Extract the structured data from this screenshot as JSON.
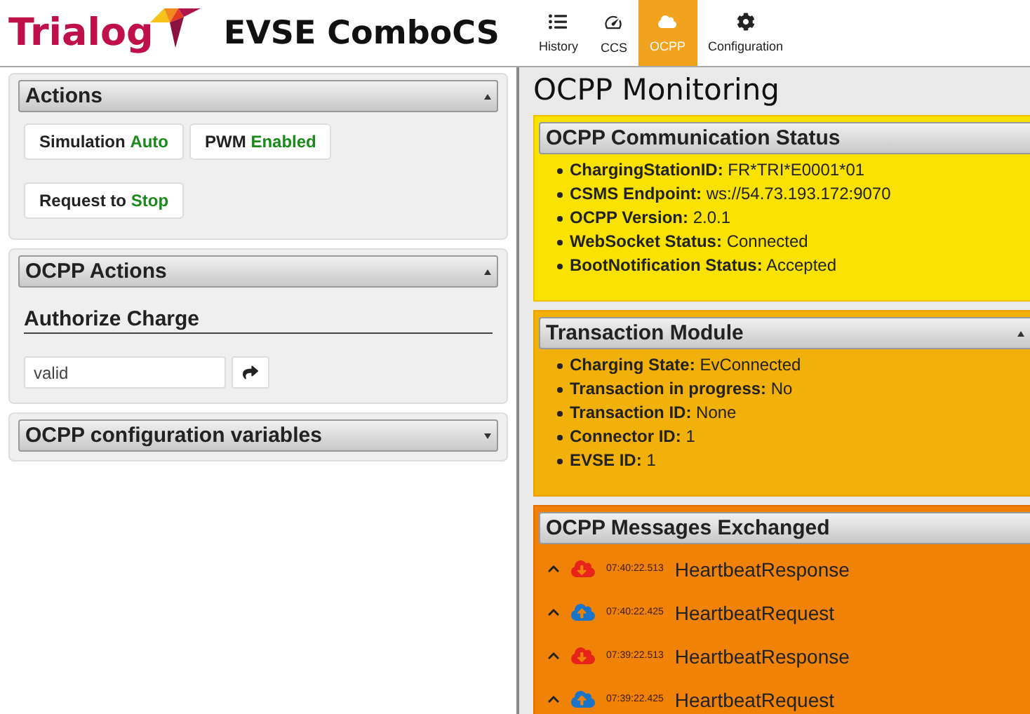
{
  "header": {
    "logo": "Trialog",
    "title": "EVSE ComboCS",
    "nav": [
      {
        "label": "History",
        "selected": false
      },
      {
        "label": "CCS",
        "selected": false
      },
      {
        "label": "OCPP",
        "selected": true
      },
      {
        "label": "Configuration",
        "selected": false
      }
    ]
  },
  "left": {
    "actions": {
      "title": "Actions",
      "expanded": true,
      "buttons": [
        {
          "label": "Simulation",
          "value": "Auto"
        },
        {
          "label": "PWM",
          "value": "Enabled"
        },
        {
          "label": "Request to",
          "value": "Stop"
        }
      ]
    },
    "ocpp_actions": {
      "title": "OCPP Actions",
      "expanded": true,
      "section": "Authorize Charge",
      "input": {
        "value": "valid"
      }
    },
    "config_vars": {
      "title": "OCPP configuration variables",
      "expanded": false
    }
  },
  "monitoring": {
    "title": "OCPP Monitoring",
    "communication": {
      "title": "OCPP Communication Status",
      "items": [
        {
          "label": "ChargingStationID:",
          "value": "FR*TRI*E0001*01"
        },
        {
          "label": "CSMS Endpoint:",
          "value": "ws://54.73.193.172:9070"
        },
        {
          "label": "OCPP Version:",
          "value": "2.0.1"
        },
        {
          "label": "WebSocket Status:",
          "value": "Connected"
        },
        {
          "label": "BootNotification Status:",
          "value": "Accepted"
        }
      ]
    },
    "transaction": {
      "title": "Transaction Module",
      "expanded": true,
      "items": [
        {
          "label": "Charging State:",
          "value": "EvConnected"
        },
        {
          "label": "Transaction in progress:",
          "value": "No"
        },
        {
          "label": "Transaction ID:",
          "value": "None"
        },
        {
          "label": "Connector ID:",
          "value": "1"
        },
        {
          "label": "EVSE ID:",
          "value": "1"
        }
      ]
    },
    "messages": {
      "title": "OCPP Messages Exchanged",
      "items": [
        {
          "kind": "response",
          "time": "07:40:22.513",
          "name": "HeartbeatResponse"
        },
        {
          "kind": "request",
          "time": "07:40:22.425",
          "name": "HeartbeatRequest"
        },
        {
          "kind": "response",
          "time": "07:39:22.513",
          "name": "HeartbeatResponse"
        },
        {
          "kind": "request",
          "time": "07:39:22.425",
          "name": "HeartbeatRequest"
        }
      ]
    }
  }
}
